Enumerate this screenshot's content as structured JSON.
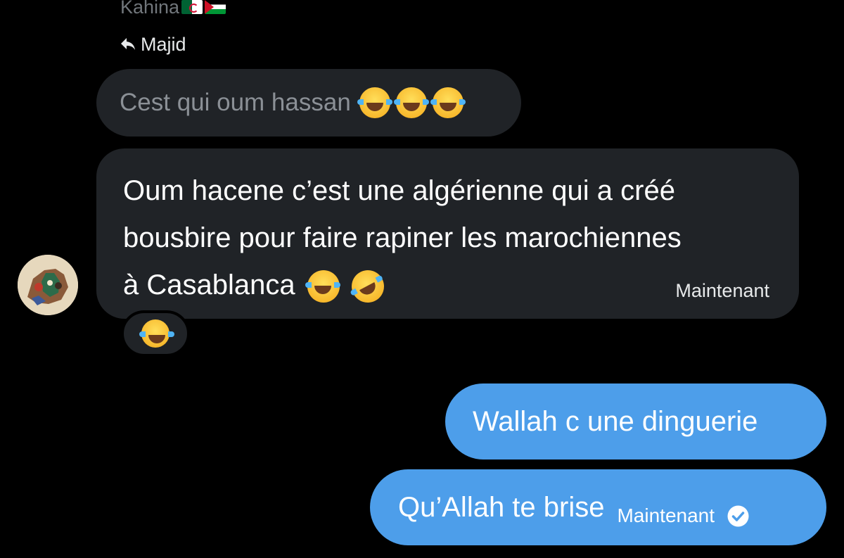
{
  "conversation": {
    "participant_name": "Kahina",
    "participant_flags": [
      "algeria-flag",
      "palestine-flag"
    ]
  },
  "reply": {
    "icon": "reply-arrow-icon",
    "to_name": "Majid",
    "quoted_text": "Cest qui oum hassan",
    "quoted_emojis": [
      "laughing-tears-emoji",
      "laughing-tears-emoji",
      "laughing-tears-emoji"
    ]
  },
  "incoming_message": {
    "line1": "Oum hacene c’est une algérienne qui a créé",
    "line2": "bousbire pour faire rapiner les marochiennes",
    "line3": "à Casablanca",
    "emojis": [
      "laughing-tears-emoji",
      "rolling-on-floor-laughing-emoji"
    ],
    "time": "Maintenant",
    "reaction": "laughing-tears-emoji"
  },
  "outgoing_messages": [
    {
      "text": "Wallah c une dinguerie"
    },
    {
      "text": "Qu’Allah te brise",
      "time": "Maintenant",
      "status_icon": "read-check-icon"
    }
  ],
  "colors": {
    "background": "#000000",
    "incoming_bubble": "#202327",
    "outgoing_bubble": "#4d9eea",
    "secondary_text": "#71767b"
  }
}
